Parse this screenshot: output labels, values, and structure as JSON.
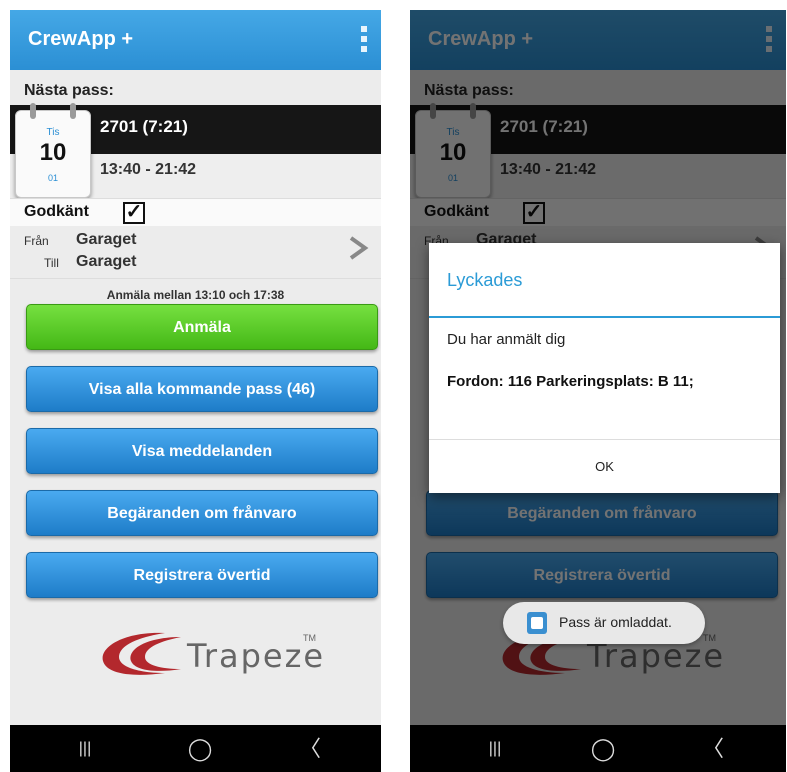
{
  "app": {
    "title": "CrewApp +"
  },
  "next_shift": {
    "label": "Nästa pass:",
    "calendar": {
      "day": "Tis",
      "date": "10",
      "month": "01"
    },
    "shift_id": "2701 (7:21)",
    "time_range": "13:40 - 21:42",
    "approved_label": "Godkänt",
    "approved_checked": true,
    "check_mark": "✓",
    "from_label": "Från",
    "from_value": "Garaget",
    "to_label": "Till",
    "to_value": "Garaget"
  },
  "report_window": "Anmäla mellan 13:10 och 17:38",
  "buttons": {
    "report": "Anmäla",
    "all_upcoming": "Visa alla kommande pass (46)",
    "messages": "Visa meddelanden",
    "absence": "Begäranden om frånvaro",
    "overtime": "Registrera övertid"
  },
  "logo": {
    "text": "Trapeze",
    "tm": "TM"
  },
  "navbar": {
    "recents": "|||",
    "home": "◯",
    "back": "〈"
  },
  "dialog": {
    "title": "Lyckades",
    "message": "Du har anmält dig",
    "detail": "Fordon: 116 Parkeringsplats: B 11;",
    "ok": "OK"
  },
  "toast": {
    "text": "Pass är omladdat."
  },
  "colors": {
    "accent": "#2b8fd4",
    "green": "#5acb2a",
    "dark_header": "#161616"
  }
}
